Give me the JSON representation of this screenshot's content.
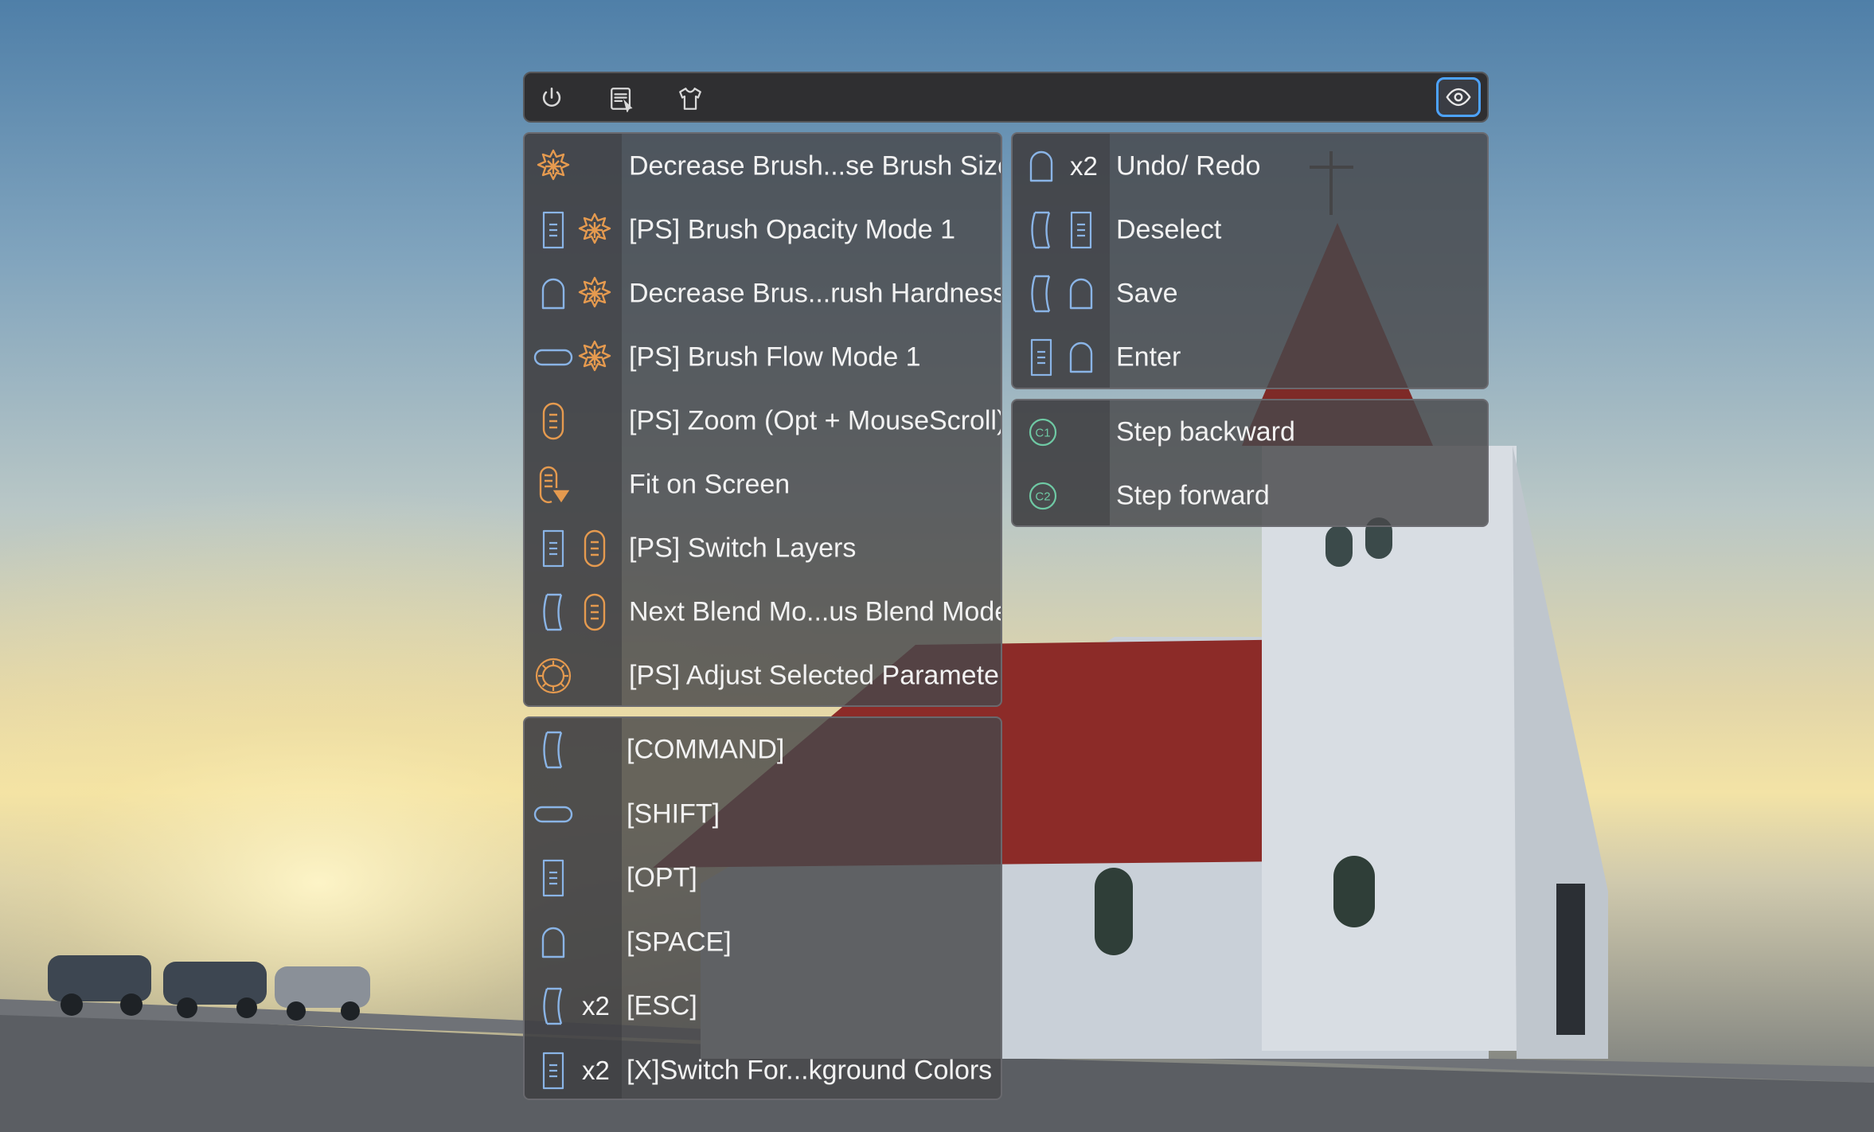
{
  "colors": {
    "orange": "#e59a4f",
    "blue": "#8ab4e6",
    "teal": "#6fc9a4",
    "accent": "#4da3ff"
  },
  "toolbar": {
    "buttons": [
      "power-icon",
      "document-cursor-icon",
      "shirt-icon"
    ],
    "eye": "eye-icon"
  },
  "left_actions": [
    {
      "icons": [
        "brush-wheel-orange"
      ],
      "label": "Decrease Brush...se Brush Size"
    },
    {
      "icons": [
        "opt-key-blue",
        "brush-wheel-orange"
      ],
      "label": "[PS] Brush Opacity Mode 1"
    },
    {
      "icons": [
        "space-key-blue",
        "brush-wheel-orange"
      ],
      "label": "Decrease Brus...rush Hardness"
    },
    {
      "icons": [
        "shift-key-blue",
        "brush-wheel-orange"
      ],
      "label": "[PS] Brush Flow Mode 1"
    },
    {
      "icons": [
        "scroll-orange"
      ],
      "label": "[PS] Zoom (Opt + MouseScroll)"
    },
    {
      "icons": [
        "scroll-press-orange"
      ],
      "label": "Fit on Screen"
    },
    {
      "icons": [
        "opt-key-blue",
        "scroll-orange"
      ],
      "label": "[PS] Switch Layers"
    },
    {
      "icons": [
        "command-key-blue",
        "scroll-orange"
      ],
      "label": "Next Blend Mo...us Blend Mode"
    },
    {
      "icons": [
        "dial-orange"
      ],
      "label": "[PS] Adjust Selected Parameter"
    }
  ],
  "left_modifiers": [
    {
      "icons": [
        "command-key-blue"
      ],
      "x2": "",
      "label": "[COMMAND]"
    },
    {
      "icons": [
        "shift-key-blue"
      ],
      "x2": "",
      "label": "[SHIFT]"
    },
    {
      "icons": [
        "opt-key-blue"
      ],
      "x2": "",
      "label": "[OPT]"
    },
    {
      "icons": [
        "space-key-blue"
      ],
      "x2": "",
      "label": "[SPACE]"
    },
    {
      "icons": [
        "command-key-blue"
      ],
      "x2": "x2",
      "label": "[ESC]"
    },
    {
      "icons": [
        "opt-key-blue"
      ],
      "x2": "x2",
      "label": "[X]Switch For...kground Colors"
    }
  ],
  "right_shortcuts": [
    {
      "icons": [
        "space-key-blue"
      ],
      "x2": "x2",
      "label": "Undo/ Redo"
    },
    {
      "icons": [
        "command-key-blue",
        "opt-key-blue"
      ],
      "x2": "",
      "label": "Deselect"
    },
    {
      "icons": [
        "command-key-blue",
        "space-key-blue"
      ],
      "x2": "",
      "label": "Save"
    },
    {
      "icons": [
        "opt-key-blue",
        "space-key-blue"
      ],
      "x2": "",
      "label": "Enter"
    }
  ],
  "right_steps": [
    {
      "badge": "C1",
      "label": "Step backward"
    },
    {
      "badge": "C2",
      "label": "Step forward"
    }
  ]
}
